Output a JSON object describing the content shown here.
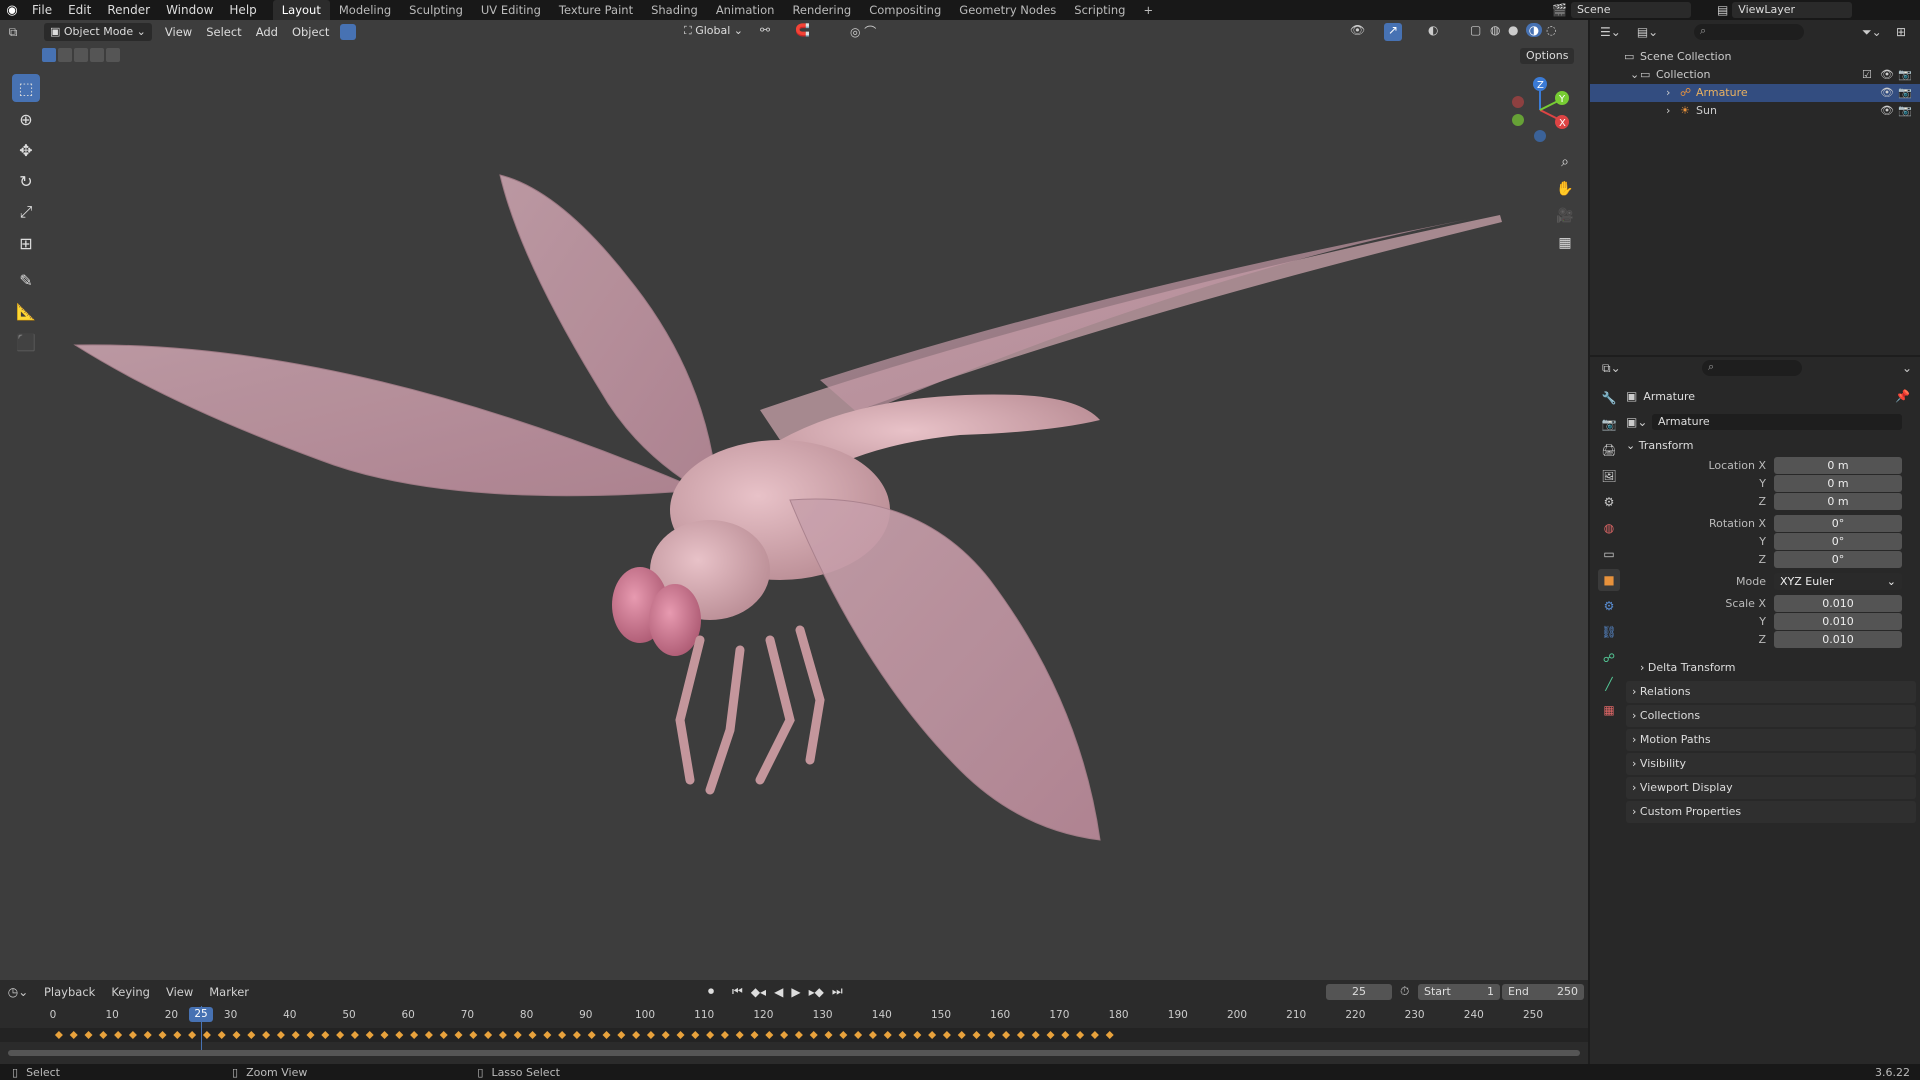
{
  "app": {
    "version": "3.6.22"
  },
  "menu": {
    "items": [
      "File",
      "Edit",
      "Render",
      "Window",
      "Help"
    ]
  },
  "workspaces": {
    "tabs": [
      "Layout",
      "Modeling",
      "Sculpting",
      "UV Editing",
      "Texture Paint",
      "Shading",
      "Animation",
      "Rendering",
      "Compositing",
      "Geometry Nodes",
      "Scripting"
    ],
    "active": "Layout",
    "add": "+"
  },
  "scene": {
    "name": "Scene",
    "view_layer": "ViewLayer"
  },
  "viewport_header": {
    "mode": "Object Mode",
    "menus": [
      "View",
      "Select",
      "Add",
      "Object"
    ],
    "orientation": "Global",
    "options": "Options"
  },
  "outliner": {
    "rows": [
      {
        "label": "Scene Collection",
        "indent": 0
      },
      {
        "label": "Collection",
        "indent": 1
      },
      {
        "label": "Armature",
        "indent": 2,
        "selected": true
      },
      {
        "label": "Sun",
        "indent": 2
      }
    ]
  },
  "properties": {
    "object_name": "Armature",
    "data_name": "Armature",
    "transform_title": "Transform",
    "location": {
      "label": "Location X",
      "x": "0 m",
      "y": "0 m",
      "z": "0 m"
    },
    "rotation": {
      "label": "Rotation X",
      "x": "0°",
      "y": "0°",
      "z": "0°"
    },
    "mode": {
      "label": "Mode",
      "value": "XYZ Euler"
    },
    "scale": {
      "label": "Scale X",
      "x": "0.010",
      "y": "0.010",
      "z": "0.010"
    },
    "axis_labels": {
      "y": "Y",
      "z": "Z"
    },
    "delta": "Delta Transform",
    "panels": [
      "Relations",
      "Collections",
      "Motion Paths",
      "Visibility",
      "Viewport Display",
      "Custom Properties"
    ]
  },
  "timeline": {
    "menus": [
      "Playback",
      "Keying",
      "View",
      "Marker"
    ],
    "current_frame": "25",
    "start_label": "Start",
    "start": "1",
    "end_label": "End",
    "end": "250",
    "ticks": [
      "0",
      "10",
      "20",
      "30",
      "40",
      "50",
      "60",
      "70",
      "80",
      "90",
      "100",
      "110",
      "120",
      "130",
      "140",
      "150",
      "160",
      "170",
      "180",
      "190",
      "200",
      "210",
      "220",
      "230",
      "240",
      "250"
    ]
  },
  "statusbar": {
    "items": [
      "Select",
      "Zoom View",
      "Lasso Select"
    ]
  },
  "colors": {
    "accent": "#4772b3",
    "selection": "#334d80",
    "keyframe": "#e8a23c",
    "wing": "#c9a2ad",
    "viewport_bg": "#3d3d3d"
  }
}
